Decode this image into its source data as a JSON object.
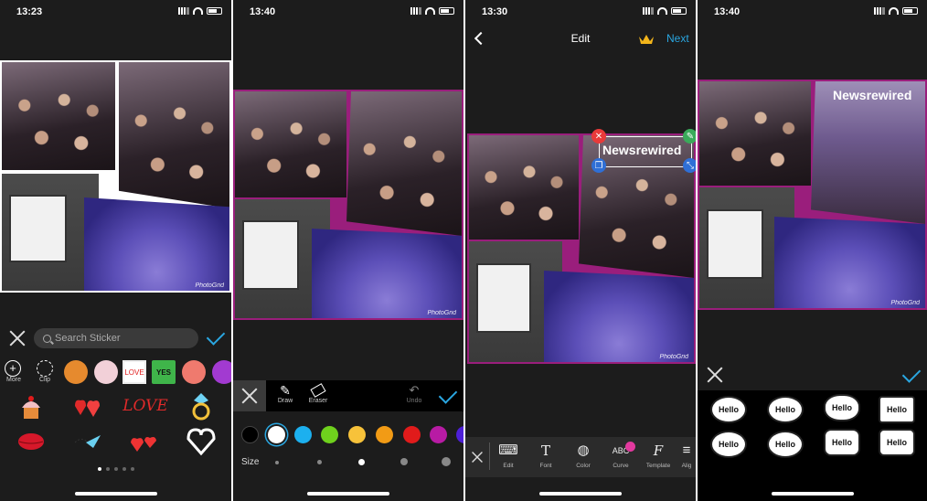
{
  "screens": [
    {
      "status_time": "13:23",
      "watermark": "PhotoGrid",
      "search_placeholder": "Search Sticker",
      "strip_labels": {
        "more": "More",
        "clip": "Clip"
      },
      "love_badge": "LOVE",
      "yes_badge": "YES",
      "stickers": [
        "cupcake-icon",
        "hearts-icon",
        "love-text-sticker",
        "ring-icon",
        "lips-icon",
        "paper-plane-icon",
        "small-hearts-icon",
        "white-heart-icon"
      ],
      "love_sticker_text": "LOVE"
    },
    {
      "status_time": "13:40",
      "watermark": "PhotoGrid",
      "tools": {
        "draw": "Draw",
        "eraser": "Eraser",
        "undo": "Undo"
      },
      "size_label": "Size",
      "colors": [
        "#000000",
        "#ffffff",
        "#1cb0ef",
        "#6fd11d",
        "#f7c23a",
        "#f29b15",
        "#e11b1b",
        "#b81ba4",
        "#4d1fd8"
      ]
    },
    {
      "status_time": "13:30",
      "nav_title": "Edit",
      "next_label": "Next",
      "text_sticker": "Newsrewired",
      "watermark": "PhotoGrid",
      "tools": [
        "Edit",
        "Font",
        "Color",
        "Curve",
        "Template",
        "Alig"
      ]
    },
    {
      "status_time": "13:40",
      "text_sticker": "Newsrewired",
      "watermark": "PhotoGrid",
      "hello_label": "Hello"
    }
  ],
  "colors": {
    "accent": "#2aa6e0",
    "crown": "#f3b51b",
    "frame": "#9a1e7c",
    "premium": "#e2399e",
    "close": "#e83a3a",
    "handle": "#2f6fd6"
  }
}
